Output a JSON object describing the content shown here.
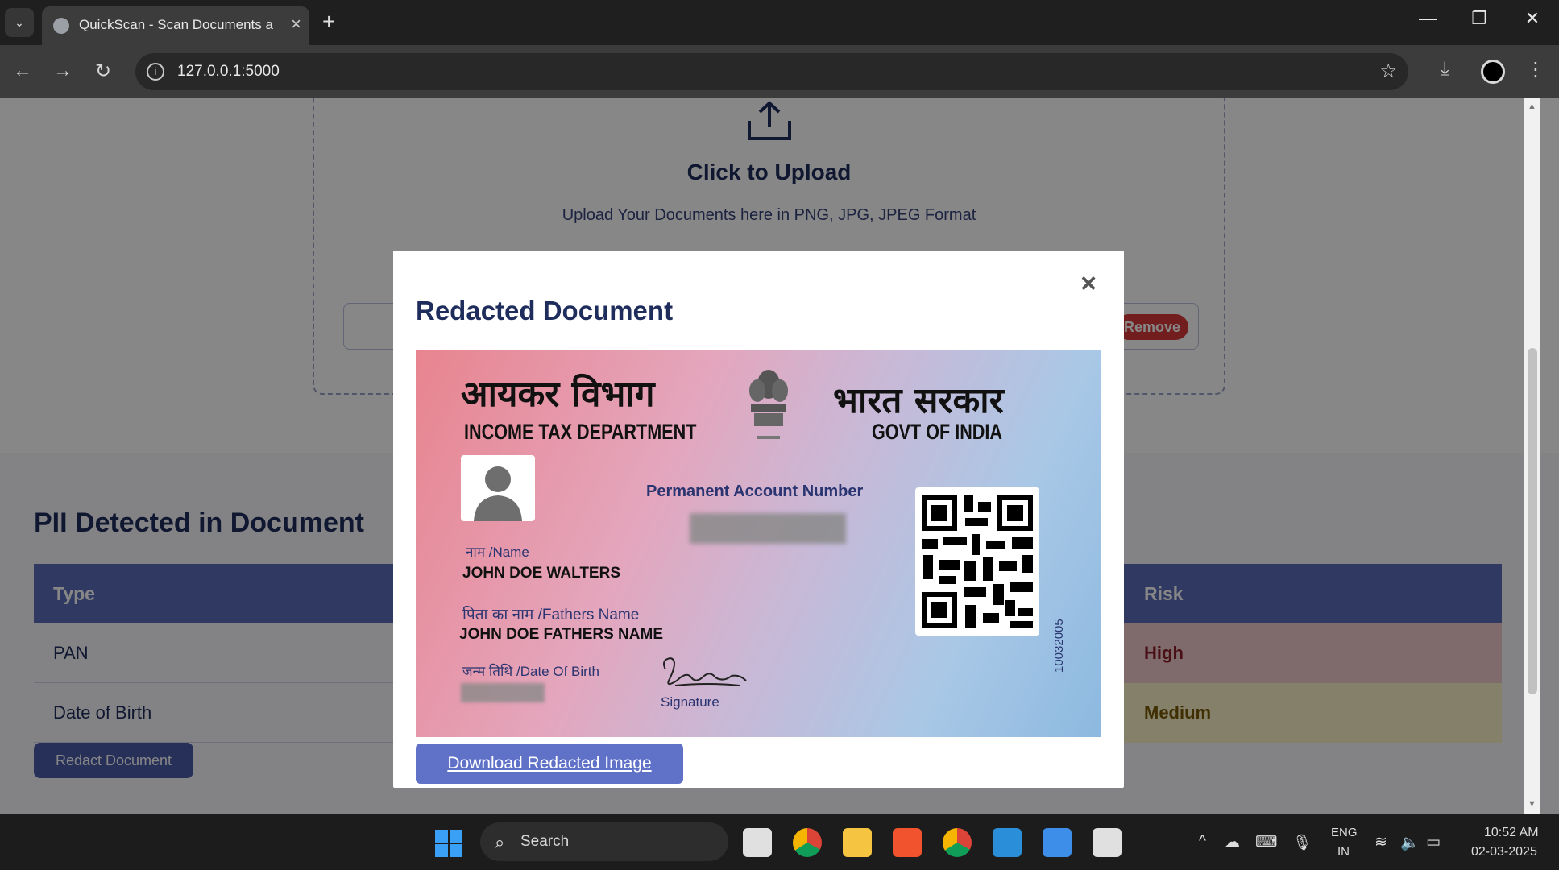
{
  "browser": {
    "tab_title": "QuickScan - Scan Documents a",
    "url": "127.0.0.1:5000"
  },
  "upload": {
    "title": "Click to Upload",
    "subtitle": "Upload Your Documents here in PNG, JPG, JPEG Format",
    "remove_label": "Remove"
  },
  "pii": {
    "title": "PII Detected in Document",
    "columns": [
      "Type",
      "Risk"
    ],
    "rows": [
      {
        "type": "PAN",
        "risk": "High",
        "risk_color": "#f0c9cc"
      },
      {
        "type": "Date of Birth",
        "risk": "Medium",
        "risk_color": "#faf1c8"
      }
    ],
    "redact_button": "Redact Document"
  },
  "modal": {
    "title": "Redacted Document",
    "close": "×",
    "download_label": "Download Redacted Image"
  },
  "pan_card": {
    "dept_hindi": "आयकर विभाग",
    "dept_english": "INCOME TAX DEPARTMENT",
    "govt_hindi": "भारत सरकार",
    "govt_english": "GOVT OF INDIA",
    "pan_label": "Permanent Account Number",
    "name_label": "नाम /Name",
    "name_value": "JOHN DOE WALTERS",
    "father_label": "पिता का नाम /Fathers Name",
    "father_value": "JOHN DOE FATHERS NAME",
    "dob_label": "जन्म तिथि /Date Of Birth",
    "signature_label": "Signature",
    "serial": "10032005"
  },
  "taskbar": {
    "search_label": "Search",
    "lang_line1": "ENG",
    "lang_line2": "IN",
    "time": "10:52 AM",
    "date": "02-03-2025"
  },
  "colors": {
    "accent": "#5a6db8",
    "title": "#1f2d5c",
    "remove": "#d93a3a"
  }
}
